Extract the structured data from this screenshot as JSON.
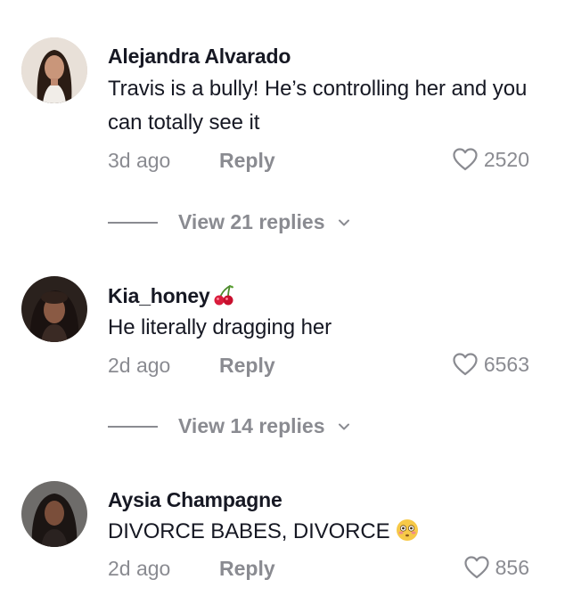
{
  "comments": [
    {
      "username": "Alejandra Alvarado",
      "text": "Travis is a bully! He’s controlling her and you can totally see it",
      "time": "3d ago",
      "reply_label": "Reply",
      "likes": "2520",
      "view_replies": "View 21 replies"
    },
    {
      "username": "Kia_honey",
      "username_icon": "cherry-icon",
      "text": "He literally dragging her",
      "time": "2d ago",
      "reply_label": "Reply",
      "likes": "6563",
      "view_replies": "View 14 replies"
    },
    {
      "username": "Aysia Champagne",
      "text": "DIVORCE BABES, DIVORCE",
      "text_icon": "flushed-face-icon",
      "time": "2d ago",
      "reply_label": "Reply",
      "likes": "856"
    }
  ],
  "colors": {
    "primary_text": "#161823",
    "secondary_text": "#8a8b91"
  }
}
